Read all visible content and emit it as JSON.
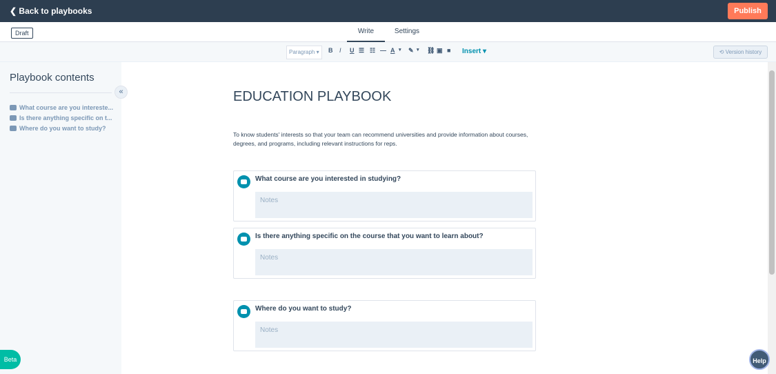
{
  "header": {
    "back_label": "Back to playbooks",
    "publish_label": "Publish"
  },
  "status": {
    "draft_label": "Draft"
  },
  "tabs": [
    {
      "label": "Write",
      "active": true
    },
    {
      "label": "Settings",
      "active": false
    }
  ],
  "toolbar": {
    "paragraph": "Paragraph",
    "bold": "B",
    "italic": "I",
    "underline": "U",
    "text_color": "A",
    "insert": "Insert",
    "version_history": "Version history"
  },
  "sidebar": {
    "title": "Playbook contents",
    "items": [
      {
        "label": "What course are you intereste..."
      },
      {
        "label": "Is there anything specific on t..."
      },
      {
        "label": "Where do you want to study?"
      }
    ]
  },
  "main": {
    "title": "EDUCATION PLAYBOOK",
    "description": "To know students' interests so that your team can recommend universities and provide information about courses, degrees, and programs, including relevant instructions for reps.",
    "questions": [
      {
        "text": "What course are you interested in studying?",
        "placeholder": "Notes"
      },
      {
        "text": "Is there anything specific on the course that you want to learn about?",
        "placeholder": "Notes"
      },
      {
        "text": "Where do you want to study?",
        "placeholder": "Notes"
      }
    ]
  },
  "footer": {
    "beta": "Beta",
    "help": "Help"
  },
  "colors": {
    "topbar": "#2d3e50",
    "publish": "#ff7a59",
    "accent": "#0091ae",
    "beta": "#00bda5"
  }
}
